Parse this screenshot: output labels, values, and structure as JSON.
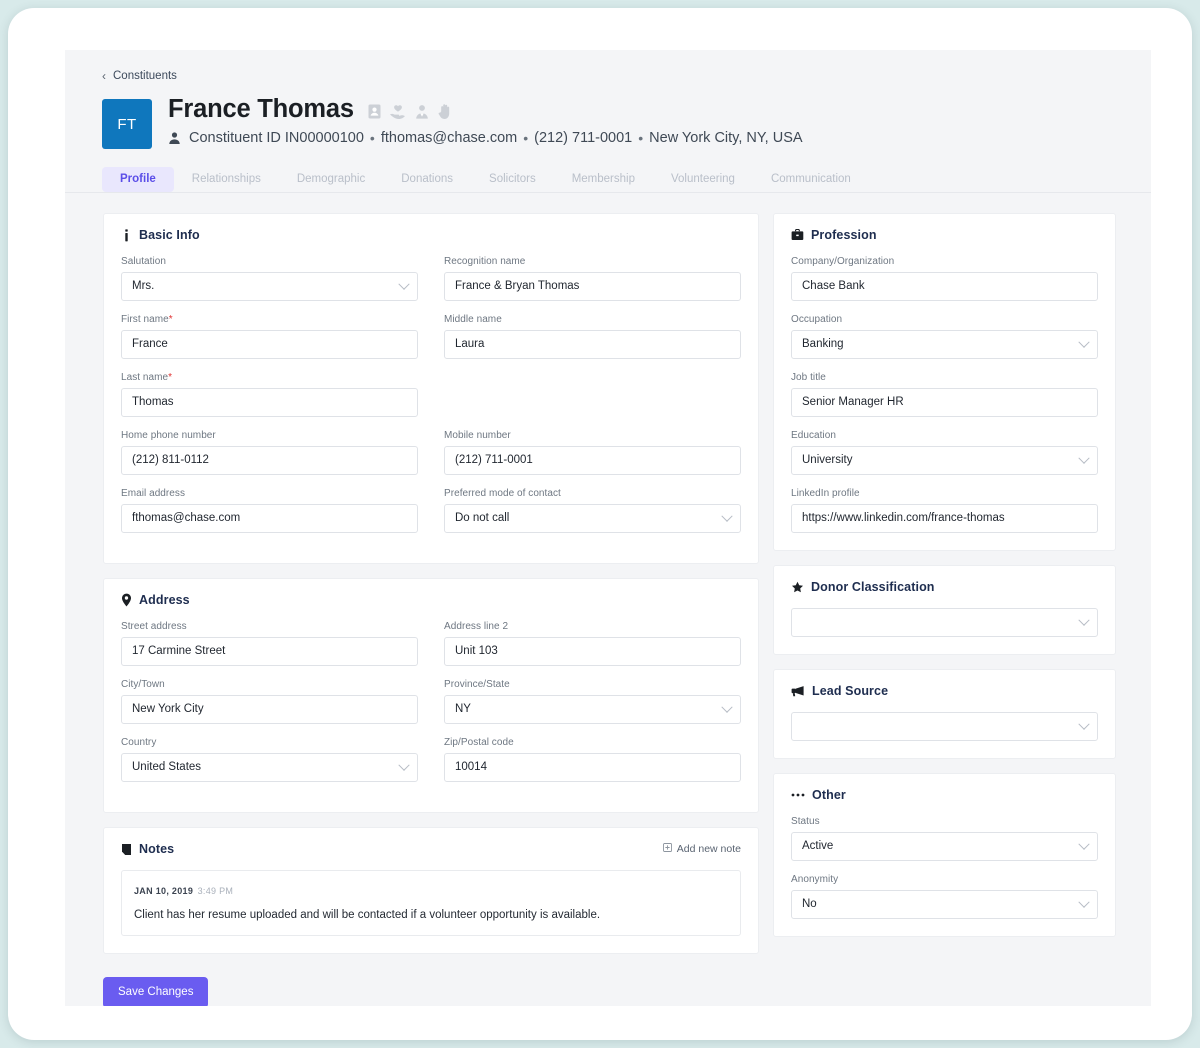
{
  "theme": {
    "accent": "#6a5cf0",
    "tab_active_bg": "#e9e7fd",
    "tab_active_text": "#5b4ee8",
    "avatar_bg": "#0f77bd",
    "heading_color": "#1e2d4f",
    "page_bg": "#f4f5f7",
    "required_marker": "#e03131"
  },
  "breadcrumb": {
    "back_icon": "chevron-left-icon",
    "label": "Constituents"
  },
  "header": {
    "avatar_initials": "FT",
    "name": "France Thomas",
    "persona_icons": [
      "id-badge-icon",
      "heart-hand-icon",
      "solicitor-person-icon",
      "raised-hand-icon"
    ],
    "meta_icon": "person-icon",
    "meta": [
      "Constituent ID IN00000100",
      "fthomas@chase.com",
      "(212) 711-0001",
      "New York City, NY, USA"
    ],
    "meta_separator": "•"
  },
  "tabs": [
    {
      "label": "Profile",
      "active": true
    },
    {
      "label": "Relationships",
      "active": false
    },
    {
      "label": "Demographic",
      "active": false
    },
    {
      "label": "Donations",
      "active": false
    },
    {
      "label": "Solicitors",
      "active": false
    },
    {
      "label": "Membership",
      "active": false
    },
    {
      "label": "Volunteering",
      "active": false
    },
    {
      "label": "Communication",
      "active": false
    }
  ],
  "basic_info": {
    "icon": "info-icon",
    "title": "Basic Info",
    "fields": {
      "salutation": {
        "label": "Salutation",
        "value": "Mrs.",
        "type": "select",
        "required": false
      },
      "recognition": {
        "label": "Recognition name",
        "value": "France & Bryan Thomas",
        "type": "text",
        "required": false
      },
      "first_name": {
        "label": "First name",
        "value": "France",
        "type": "text",
        "required": true
      },
      "middle_name": {
        "label": "Middle name",
        "value": "Laura",
        "type": "text",
        "required": false
      },
      "last_name": {
        "label": "Last name",
        "value": "Thomas",
        "type": "text",
        "required": true
      },
      "home_phone": {
        "label": "Home phone number",
        "value": "(212) 811-0112",
        "type": "text",
        "required": false
      },
      "mobile": {
        "label": "Mobile number",
        "value": "(212) 711-0001",
        "type": "text",
        "required": false
      },
      "email": {
        "label": "Email address",
        "value": "fthomas@chase.com",
        "type": "text",
        "required": false
      },
      "pref_contact": {
        "label": "Preferred mode of contact",
        "value": "Do not call",
        "type": "select",
        "required": false
      }
    }
  },
  "address": {
    "icon": "location-pin-icon",
    "title": "Address",
    "fields": {
      "street": {
        "label": "Street address",
        "value": "17 Carmine Street",
        "type": "text"
      },
      "line2": {
        "label": "Address line 2",
        "value": "Unit 103",
        "type": "text"
      },
      "city": {
        "label": "City/Town",
        "value": "New York City",
        "type": "text"
      },
      "province": {
        "label": "Province/State",
        "value": "NY",
        "type": "select"
      },
      "country": {
        "label": "Country",
        "value": "United States",
        "type": "select"
      },
      "zip": {
        "label": "Zip/Postal code",
        "value": "10014",
        "type": "text"
      }
    }
  },
  "notes": {
    "icon": "note-icon",
    "title": "Notes",
    "add_button": {
      "icon": "plus-square-icon",
      "label": "Add new note"
    },
    "items": [
      {
        "date": "JAN 10, 2019",
        "time": "3:49 PM",
        "body": "Client has her resume uploaded and will be contacted if a volunteer opportunity is available."
      }
    ]
  },
  "profession": {
    "icon": "briefcase-icon",
    "title": "Profession",
    "fields": {
      "company": {
        "label": "Company/Organization",
        "value": "Chase Bank",
        "type": "text"
      },
      "occupation": {
        "label": "Occupation",
        "value": "Banking",
        "type": "select"
      },
      "job_title": {
        "label": "Job title",
        "value": "Senior Manager HR",
        "type": "text"
      },
      "education": {
        "label": "Education",
        "value": "University",
        "type": "select"
      },
      "linkedin": {
        "label": "LinkedIn profile",
        "value": "https://www.linkedin.com/france-thomas",
        "type": "text"
      }
    }
  },
  "donor_classification": {
    "icon": "star-icon",
    "title": "Donor Classification",
    "fields": {
      "classification": {
        "label": "",
        "value": "",
        "type": "select"
      }
    }
  },
  "lead_source": {
    "icon": "megaphone-icon",
    "title": "Lead Source",
    "fields": {
      "source": {
        "label": "",
        "value": "",
        "type": "select"
      }
    }
  },
  "other": {
    "icon": "ellipsis-icon",
    "title": "Other",
    "fields": {
      "status": {
        "label": "Status",
        "value": "Active",
        "type": "select"
      },
      "anonymity": {
        "label": "Anonymity",
        "value": "No",
        "type": "select"
      }
    }
  },
  "footer": {
    "save_label": "Save Changes"
  }
}
